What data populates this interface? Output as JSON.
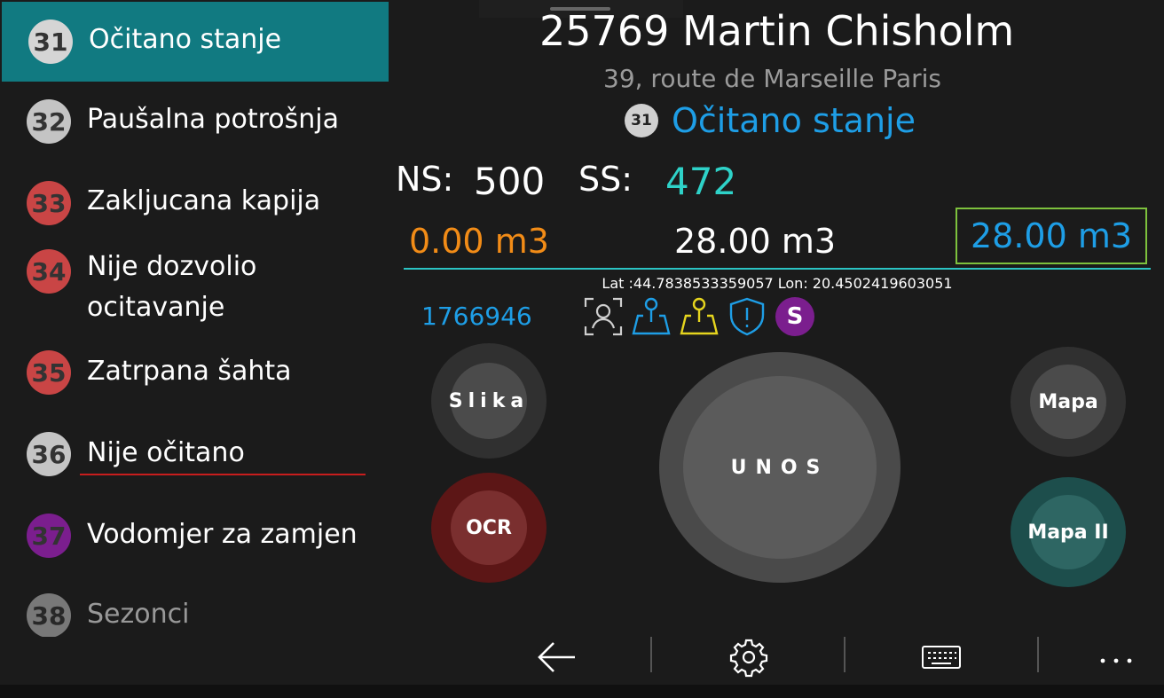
{
  "sidebar": {
    "items": [
      {
        "number": "31",
        "label": "Očitano stanje",
        "badge_color": "#d5d5d5",
        "selected": true
      },
      {
        "number": "32",
        "label": "Paušalna potrošnja",
        "badge_color": "#c4c4c4"
      },
      {
        "number": "33",
        "label": "Zakljucana kapija",
        "badge_color": "#c94545"
      },
      {
        "number": "34",
        "label_line1": "Nije dozvolio",
        "label_line2": "ocitavanje",
        "badge_color": "#c94545"
      },
      {
        "number": "35",
        "label": "Zatrpana šahta",
        "badge_color": "#c94545"
      },
      {
        "number": "36",
        "label": "Nije očitano",
        "badge_color": "#c4c4c4"
      },
      {
        "number": "37",
        "label": "Vodomjer za zamjen",
        "badge_color": "#7b1e8e"
      },
      {
        "number": "38",
        "label": "Sezonci",
        "badge_color": "#c4c4c4"
      }
    ],
    "selected_color": "#117a81"
  },
  "header": {
    "title": "25769 Martin Chisholm",
    "address": "39, route de Marseille Paris",
    "status_number": "31",
    "status_label": "Očitano stanje"
  },
  "readings": {
    "ns_label": "NS:",
    "ns_value": "500",
    "ss_label": "SS:",
    "ss_value": "472",
    "consumption_orange": "0.00 m3",
    "consumption_white": "28.00 m3",
    "consumption_box": "28.00 m3"
  },
  "gps": "Lat :44.7838533359057 Lon: 20.4502419603051",
  "meter_id": "1766946",
  "icons": [
    "person-scan-icon",
    "map-pin-blue-icon",
    "map-pin-yellow-icon",
    "shield-alert-icon",
    "s-badge-icon"
  ],
  "s_badge": "S",
  "buttons": {
    "slika": "Slika",
    "ocr": "OCR",
    "unos": "UNOS",
    "mapa": "Mapa",
    "mapa2": "Mapa II"
  },
  "bottom_bar": {
    "items": [
      "back-arrow-icon",
      "settings-icon",
      "keyboard-icon",
      "more-icon"
    ],
    "more": "..."
  },
  "colors": {
    "accent_blue": "#1e9ee6",
    "teal": "#2ed2c8",
    "orange": "#f28c17",
    "box_border": "#7ec23d"
  }
}
